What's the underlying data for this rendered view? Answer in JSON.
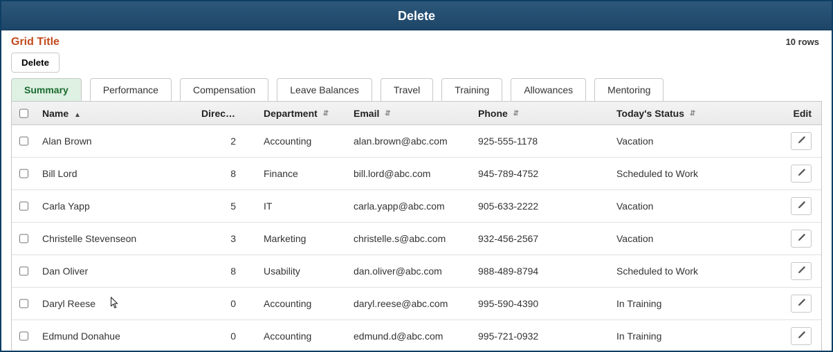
{
  "header": {
    "title": "Delete"
  },
  "grid": {
    "title": "Grid Title",
    "row_count_label": "10 rows",
    "delete_label": "Delete",
    "tabs": [
      {
        "label": "Summary",
        "active": true
      },
      {
        "label": "Performance"
      },
      {
        "label": "Compensation"
      },
      {
        "label": "Leave Balances"
      },
      {
        "label": "Travel"
      },
      {
        "label": "Training"
      },
      {
        "label": "Allowances"
      },
      {
        "label": "Mentoring"
      }
    ],
    "columns": {
      "name": "Name",
      "directs": "Directs",
      "department": "Department",
      "email": "Email",
      "phone": "Phone",
      "status": "Today's Status",
      "edit": "Edit"
    },
    "rows": [
      {
        "name": "Alan Brown",
        "directs": "2",
        "department": "Accounting",
        "email": "alan.brown@abc.com",
        "phone": "925-555-1178",
        "status": "Vacation"
      },
      {
        "name": "Bill Lord",
        "directs": "8",
        "department": "Finance",
        "email": "bill.lord@abc.com",
        "phone": "945-789-4752",
        "status": "Scheduled to Work"
      },
      {
        "name": "Carla Yapp",
        "directs": "5",
        "department": "IT",
        "email": "carla.yapp@abc.com",
        "phone": "905-633-2222",
        "status": "Vacation"
      },
      {
        "name": "Christelle Stevenseon",
        "directs": "3",
        "department": "Marketing",
        "email": "christelle.s@abc.com",
        "phone": "932-456-2567",
        "status": "Vacation"
      },
      {
        "name": "Dan Oliver",
        "directs": "8",
        "department": "Usability",
        "email": "dan.oliver@abc.com",
        "phone": "988-489-8794",
        "status": "Scheduled to Work"
      },
      {
        "name": "Daryl Reese",
        "directs": "0",
        "department": "Accounting",
        "email": "daryl.reese@abc.com",
        "phone": "995-590-4390",
        "status": "In Training"
      },
      {
        "name": "Edmund Donahue",
        "directs": "0",
        "department": "Accounting",
        "email": "edmund.d@abc.com",
        "phone": "995-721-0932",
        "status": "In Training"
      }
    ]
  }
}
